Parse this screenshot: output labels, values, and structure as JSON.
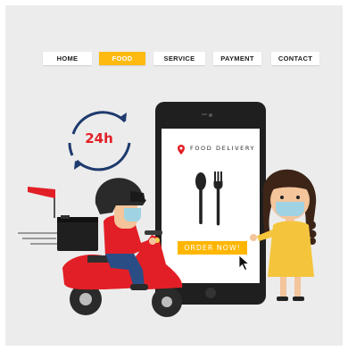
{
  "nav": {
    "items": [
      {
        "label": "HOME"
      },
      {
        "label": "FOOD"
      },
      {
        "label": "SERVICE"
      },
      {
        "label": "PAYMENT"
      },
      {
        "label": "CONTACT"
      }
    ],
    "active": "FOOD"
  },
  "illustration": {
    "clock_badge": "24h",
    "brand": "FOOD DELIVERY",
    "order_button": "ORDER NOW!"
  },
  "colors": {
    "accent": "#ffba12",
    "red": "#e21f26",
    "phone": "#1f1f1f",
    "background": "#ececec"
  },
  "icons": [
    "clock-arrows-icon",
    "location-pin-icon",
    "spoon-icon",
    "fork-icon",
    "cursor-icon",
    "flag-icon"
  ]
}
